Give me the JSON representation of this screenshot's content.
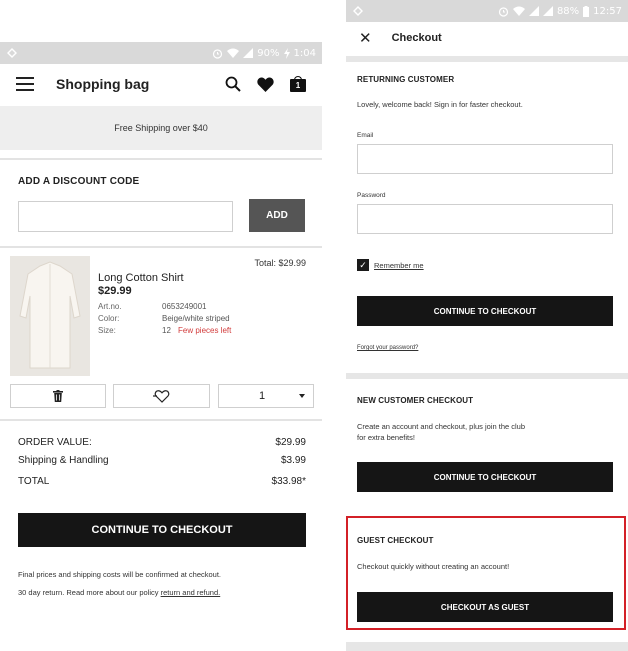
{
  "left": {
    "status": {
      "battery": "90%",
      "time": "1:04"
    },
    "header": {
      "title": "Shopping bag",
      "bag_count": "1"
    },
    "banner": "Free Shipping over $40",
    "discount": {
      "title": "ADD A DISCOUNT CODE",
      "placeholder": "",
      "button": "ADD"
    },
    "product": {
      "total": "Total: $29.99",
      "name": "Long Cotton Shirt",
      "price": "$29.99",
      "artno_label": "Art.no.",
      "artno": "0653249001",
      "color_label": "Color:",
      "color": "Beige/white striped",
      "size_label": "Size:",
      "size": "12",
      "stock_note": "Few pieces left",
      "quantity": "1"
    },
    "summary": {
      "order_label": "ORDER VALUE:",
      "order_value": "$29.99",
      "shipping_label": "Shipping & Handling",
      "shipping_value": "$3.99",
      "total_label": "TOTAL",
      "total_value": "$33.98*"
    },
    "checkout_button": "CONTINUE TO CHECKOUT",
    "fine_print_1": "Final prices and shipping costs will be confirmed at checkout.",
    "fine_print_2": "30 day return. Read more about our policy",
    "fine_print_link": "return and refund."
  },
  "right": {
    "status": {
      "battery": "88%",
      "time": "12:57"
    },
    "header": {
      "title": "Checkout"
    },
    "returning": {
      "title": "RETURNING CUSTOMER",
      "text": "Lovely, welcome back! Sign in for faster checkout.",
      "email_label": "Email",
      "password_label": "Password",
      "remember": "Remember me",
      "button": "CONTINUE TO CHECKOUT",
      "forgot": "Forgot your password?"
    },
    "new_customer": {
      "title": "NEW CUSTOMER CHECKOUT",
      "text_1": "Create an account and checkout, plus join the club",
      "text_2": "for extra benefits!",
      "button": "CONTINUE TO CHECKOUT"
    },
    "guest": {
      "title": "GUEST CHECKOUT",
      "text": "Checkout quickly without creating an account!",
      "button": "CHECKOUT AS GUEST"
    }
  },
  "colors": {
    "accent_black": "#151515",
    "highlight_red": "#d32027",
    "stock_red": "#d23b3b",
    "status_grey": "#d9d9d9"
  },
  "icons": [
    "menu-icon",
    "search-icon",
    "heart-icon",
    "bag-icon",
    "trash-icon",
    "heart-plus-icon",
    "chevron-down-icon",
    "close-icon",
    "checkbox-icon",
    "alarm-icon",
    "wifi-icon",
    "signal-icon",
    "battery-icon"
  ]
}
